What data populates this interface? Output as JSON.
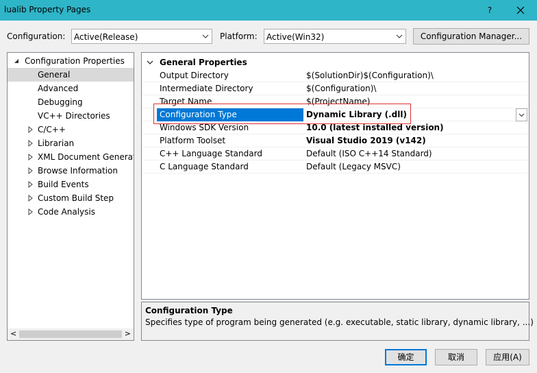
{
  "window": {
    "title": "lualib Property Pages",
    "help_label": "?",
    "close_label": "✕"
  },
  "toolbar": {
    "configuration_label": "Configuration:",
    "configuration_value": "Active(Release)",
    "platform_label": "Platform:",
    "platform_value": "Active(Win32)",
    "config_manager_label": "Configuration Manager..."
  },
  "tree": {
    "root": "Configuration Properties",
    "items": [
      {
        "label": "General",
        "expandable": false,
        "selected": true
      },
      {
        "label": "Advanced",
        "expandable": false
      },
      {
        "label": "Debugging",
        "expandable": false
      },
      {
        "label": "VC++ Directories",
        "expandable": false
      },
      {
        "label": "C/C++",
        "expandable": true
      },
      {
        "label": "Librarian",
        "expandable": true
      },
      {
        "label": "XML Document Generat",
        "expandable": true
      },
      {
        "label": "Browse Information",
        "expandable": true
      },
      {
        "label": "Build Events",
        "expandable": true
      },
      {
        "label": "Custom Build Step",
        "expandable": true
      },
      {
        "label": "Code Analysis",
        "expandable": true
      }
    ],
    "scroll_left": "<",
    "scroll_right": ">"
  },
  "grid": {
    "section": "General Properties",
    "rows": [
      {
        "name": "Output Directory",
        "value": "$(SolutionDir)$(Configuration)\\",
        "bold": false
      },
      {
        "name": "Intermediate Directory",
        "value": "$(Configuration)\\",
        "bold": false
      },
      {
        "name": "Target Name",
        "value": "$(ProjectName)",
        "bold": false
      },
      {
        "name": "Configuration Type",
        "value": "Dynamic Library (.dll)",
        "bold": true,
        "selected": true
      },
      {
        "name": "Windows SDK Version",
        "value": "10.0 (latest installed version)",
        "bold": true
      },
      {
        "name": "Platform Toolset",
        "value": "Visual Studio 2019 (v142)",
        "bold": true
      },
      {
        "name": "C++ Language Standard",
        "value": "Default (ISO C++14 Standard)",
        "bold": false
      },
      {
        "name": "C Language Standard",
        "value": "Default (Legacy MSVC)",
        "bold": false
      }
    ]
  },
  "description": {
    "title": "Configuration Type",
    "text": "Specifies type of program being generated (e.g. executable, static library, dynamic library, ...)"
  },
  "buttons": {
    "ok": "确定",
    "cancel": "取消",
    "apply": "应用(A)"
  },
  "colors": {
    "titlebar": "#2fb5c8",
    "selection": "#0078d7",
    "annotation": "#e03030"
  }
}
